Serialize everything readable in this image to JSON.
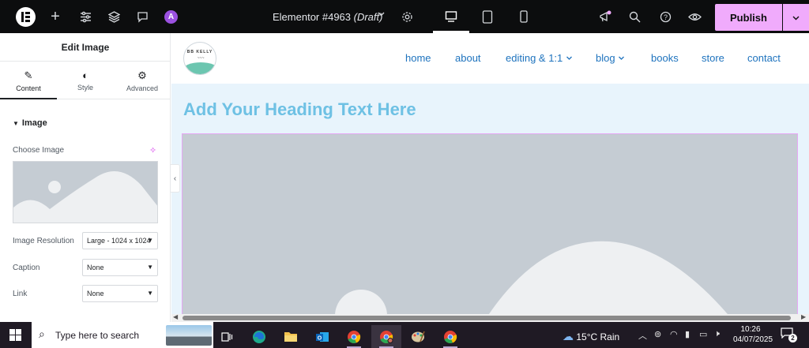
{
  "topbar": {
    "doc_title": "Elementor #4963",
    "doc_status": "(Draft)",
    "ai_badge": "A",
    "publish_label": "Publish",
    "icons": [
      "elementor-logo",
      "add-icon",
      "settings-sliders-icon",
      "layers-icon",
      "comments-icon",
      "ai-icon",
      "doc-settings-gear-icon",
      "desktop-icon",
      "tablet-icon",
      "mobile-icon",
      "whats-new-icon",
      "search-icon",
      "help-icon",
      "preview-eye-icon"
    ]
  },
  "panel": {
    "title": "Edit Image",
    "tabs": [
      {
        "label": "Content",
        "icon": "pencil-icon"
      },
      {
        "label": "Style",
        "icon": "half-circle-icon"
      },
      {
        "label": "Advanced",
        "icon": "gear-icon"
      }
    ],
    "section_title": "Image",
    "choose_image_label": "Choose Image",
    "fields": [
      {
        "label": "Image Resolution",
        "value": "Large - 1024 x 1024"
      },
      {
        "label": "Caption",
        "value": "None"
      },
      {
        "label": "Link",
        "value": "None"
      }
    ]
  },
  "site": {
    "logo_text": "BB KELLY",
    "nav": [
      {
        "label": "home",
        "dropdown": false
      },
      {
        "label": "about",
        "dropdown": false
      },
      {
        "label": "editing & 1:1",
        "dropdown": true
      },
      {
        "label": "blog",
        "dropdown": true
      },
      {
        "label": "books",
        "dropdown": false
      },
      {
        "label": "store",
        "dropdown": false
      },
      {
        "label": "contact",
        "dropdown": false
      }
    ],
    "heading": "Add Your Heading Text Here"
  },
  "taskbar": {
    "search_placeholder": "Type here to search",
    "weather_temp": "15°C",
    "weather_desc": "Rain",
    "time": "10:26",
    "date": "04/07/2025",
    "notification_count": "2"
  },
  "colors": {
    "accent_pink": "#f0abfc",
    "heading_blue": "#6ec1e4",
    "nav_blue": "#1e73be",
    "placeholder_gray": "#c5ccd3"
  }
}
